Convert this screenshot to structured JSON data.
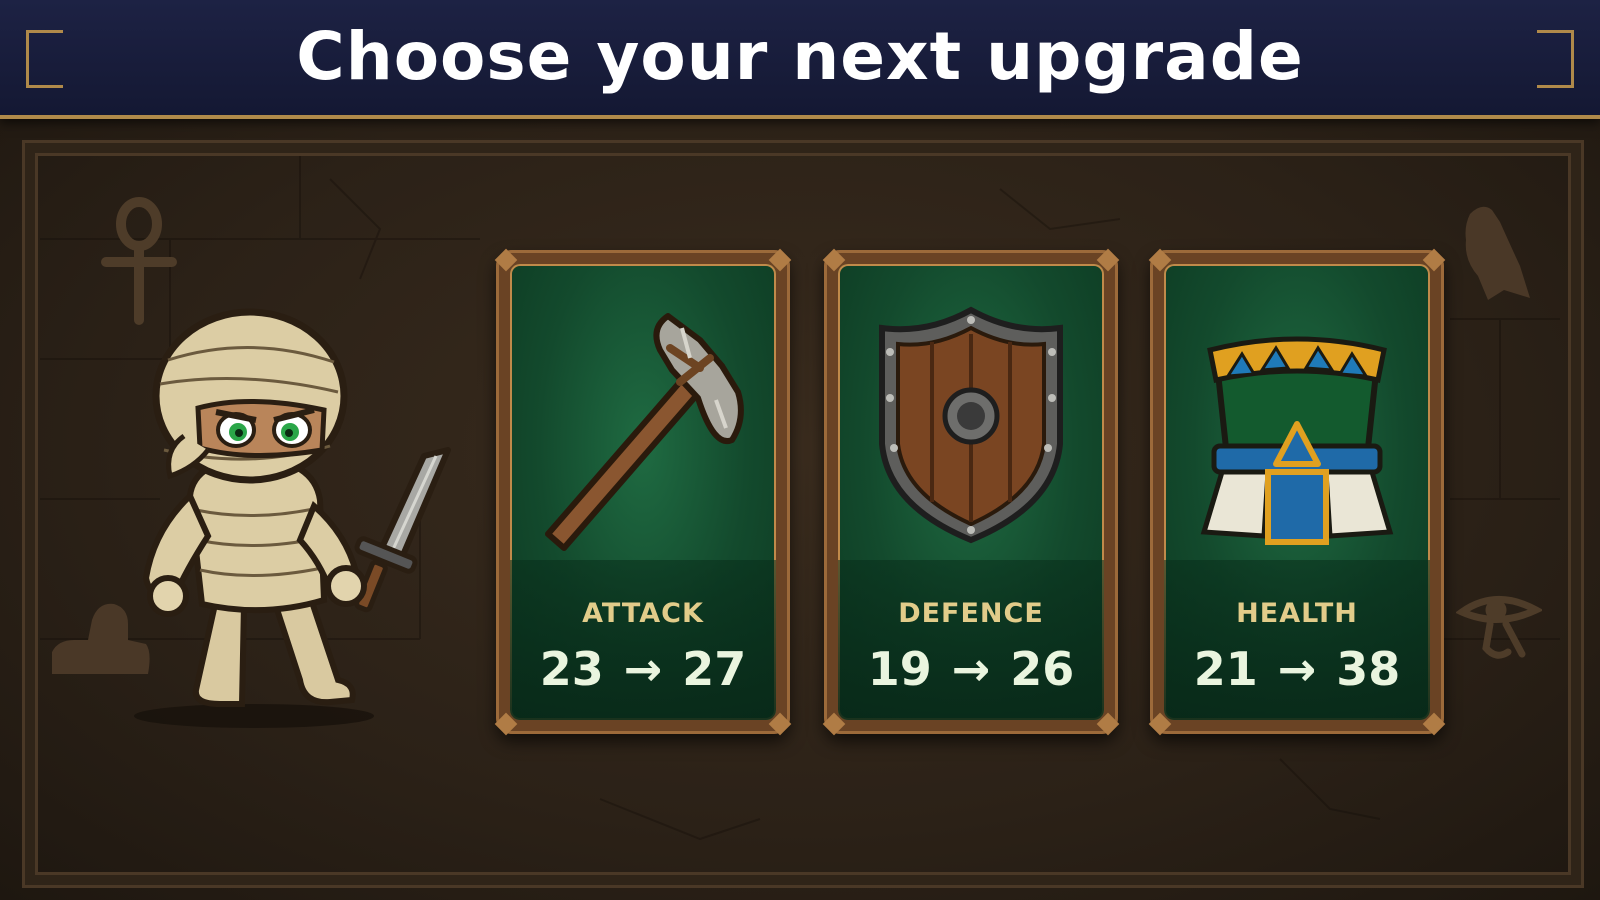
{
  "header": {
    "title": "Choose your next upgrade"
  },
  "cards": [
    {
      "stat": "ATTACK",
      "current": "23",
      "arrow": "→",
      "next": "27",
      "icon": "stone-axe-icon"
    },
    {
      "stat": "DEFENCE",
      "current": "19",
      "arrow": "→",
      "next": "26",
      "icon": "wooden-shield-icon"
    },
    {
      "stat": "HEALTH",
      "current": "21",
      "arrow": "→",
      "next": "38",
      "icon": "egyptian-armor-icon"
    }
  ],
  "character": {
    "name_icon": "mummy-character-icon"
  },
  "colors": {
    "header_bg": "#1d2244",
    "accent_gold": "#b08a4a",
    "card_green": "#134a2d",
    "stat_label": "#e2cc8a"
  }
}
